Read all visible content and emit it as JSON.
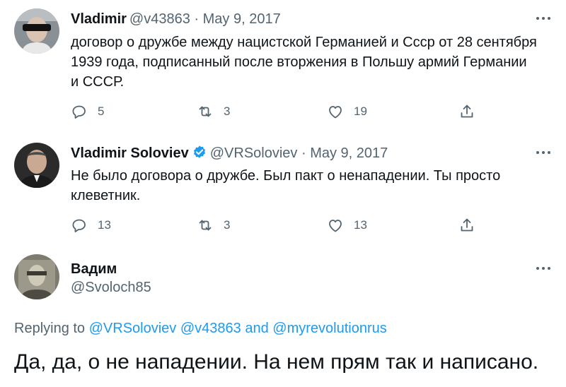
{
  "tweets": [
    {
      "name": "Vladimir",
      "handle": "@v43863",
      "sep": "·",
      "date": "May 9, 2017",
      "text": "договор о дружбе между нацистской Германией и Ссср от 28 сентября 1939 года, подписанный после вторжения в Польшу армий Германии и СССР.",
      "replies": "5",
      "retweets": "3",
      "likes": "19",
      "verified": false
    },
    {
      "name": "Vladimir Soloviev",
      "handle": "@VRSoloviev",
      "sep": "·",
      "date": "May 9, 2017",
      "text": "Не было договора о дружбе. Был пакт о ненападении. Ты просто клеветник.",
      "replies": "13",
      "retweets": "3",
      "likes": "13",
      "verified": true
    }
  ],
  "focused": {
    "name": "Вадим",
    "handle": "@Svoloch85",
    "replying_prefix": "Replying to",
    "mention_1": "@VRSoloviev",
    "mention_2": "@v43863",
    "and": "and",
    "mention_3": "@myrevolutionrus",
    "text": "Да, да, о не нападении. На нем прям так и написано."
  },
  "colors": {
    "accent": "#1d9bf0",
    "secondary_text": "#536471",
    "primary_text": "#0f1419"
  },
  "icons": [
    "reply-icon",
    "retweet-icon",
    "like-icon",
    "share-icon",
    "more-icon",
    "verified-badge-icon"
  ]
}
